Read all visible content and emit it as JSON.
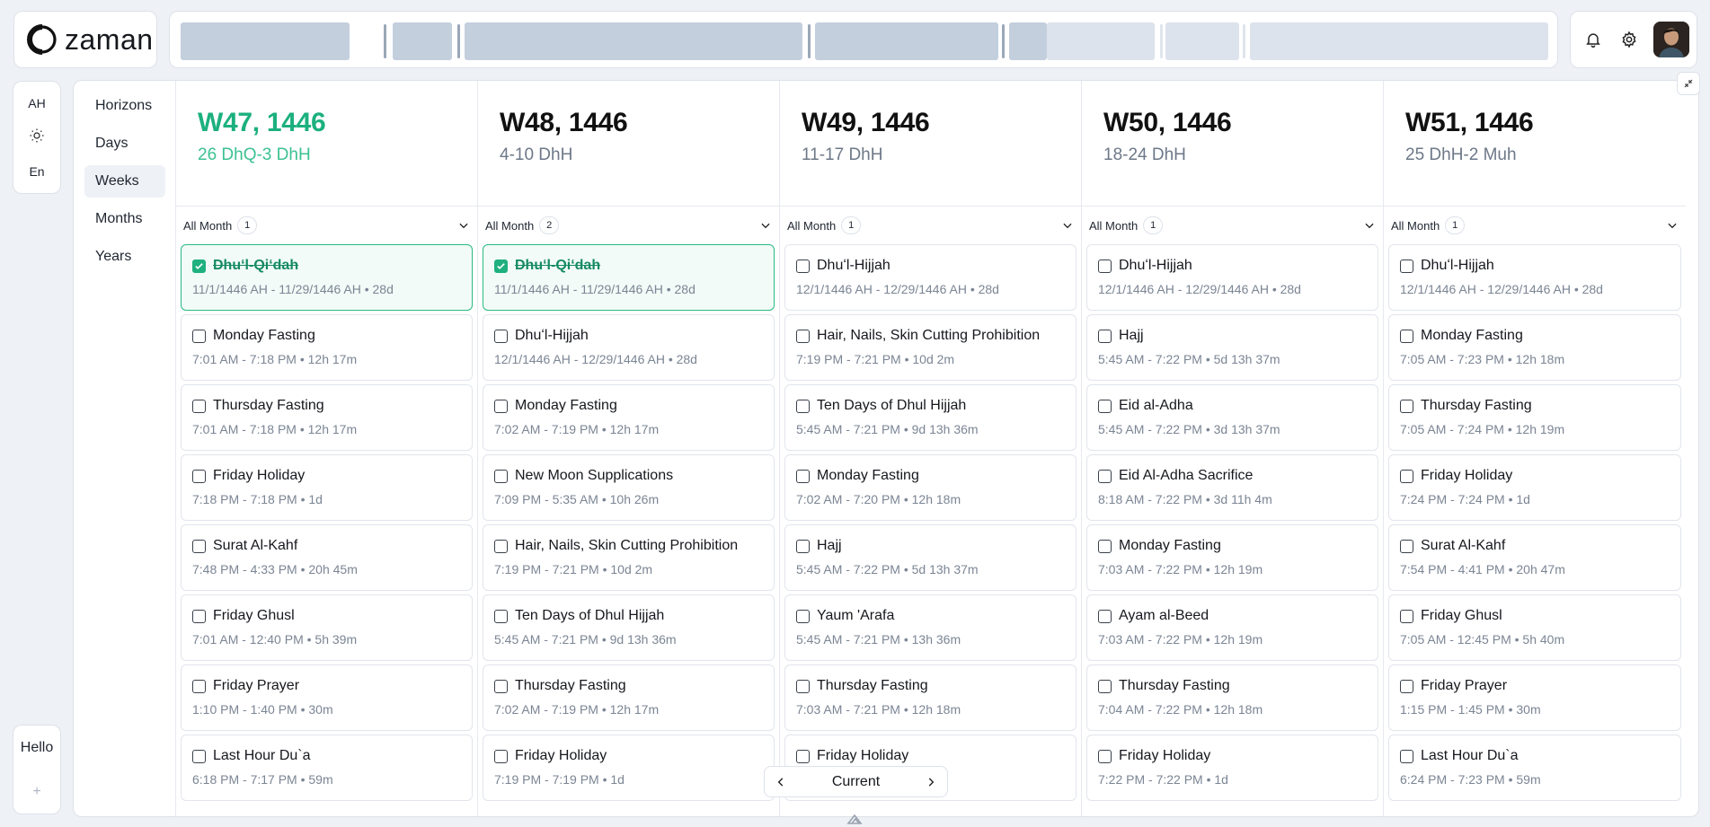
{
  "app": {
    "name": "zaman"
  },
  "rail": {
    "calendar_label": "AH",
    "language_label": "En",
    "theme_icon": "sun-icon"
  },
  "hello": {
    "label": "Hello",
    "add_icon": "plus-icon"
  },
  "header_icons": [
    "bell-icon",
    "gear-icon",
    "avatar"
  ],
  "nav": {
    "items": [
      {
        "label": "Horizons"
      },
      {
        "label": "Days"
      },
      {
        "label": "Weeks"
      },
      {
        "label": "Months"
      },
      {
        "label": "Years"
      }
    ]
  },
  "columns": [
    {
      "title": "W47, 1446",
      "subtitle": "26 DhQ-3 DhH",
      "filter": "All Month",
      "count": "1",
      "cards": [
        {
          "title": "Dhuʻl-Qiʻdah",
          "meta": "11/1/1446 AH - 11/29/1446 AH • 28d",
          "done": true
        },
        {
          "title": "Monday Fasting",
          "meta": "7:01 AM - 7:18 PM • 12h 17m"
        },
        {
          "title": "Thursday Fasting",
          "meta": "7:01 AM - 7:18 PM • 12h 17m"
        },
        {
          "title": "Friday Holiday",
          "meta": "7:18 PM - 7:18 PM • 1d"
        },
        {
          "title": "Surat Al-Kahf",
          "meta": "7:48 PM - 4:33 PM • 20h 45m"
        },
        {
          "title": "Friday Ghusl",
          "meta": "7:01 AM - 12:40 PM • 5h 39m"
        },
        {
          "title": "Friday Prayer",
          "meta": "1:10 PM - 1:40 PM • 30m"
        },
        {
          "title": "Last Hour Du`a",
          "meta": "6:18 PM - 7:17 PM • 59m"
        }
      ]
    },
    {
      "title": "W48, 1446",
      "subtitle": "4-10 DhH",
      "filter": "All Month",
      "count": "2",
      "cards": [
        {
          "title": "Dhuʻl-Qiʻdah",
          "meta": "11/1/1446 AH - 11/29/1446 AH • 28d",
          "done": true
        },
        {
          "title": "Dhuʻl-Hijjah",
          "meta": "12/1/1446 AH - 12/29/1446 AH • 28d"
        },
        {
          "title": "Monday Fasting",
          "meta": "7:02 AM - 7:19 PM • 12h 17m"
        },
        {
          "title": "New Moon Supplications",
          "meta": "7:09 PM - 5:35 AM • 10h 26m"
        },
        {
          "title": "Hair, Nails, Skin Cutting Prohibition",
          "meta": "7:19 PM - 7:21 PM • 10d 2m"
        },
        {
          "title": "Ten Days of Dhul Hijjah",
          "meta": "5:45 AM - 7:21 PM • 9d 13h 36m"
        },
        {
          "title": "Thursday Fasting",
          "meta": "7:02 AM - 7:19 PM • 12h 17m"
        },
        {
          "title": "Friday Holiday",
          "meta": "7:19 PM - 7:19 PM • 1d"
        }
      ]
    },
    {
      "title": "W49, 1446",
      "subtitle": "11-17 DhH",
      "filter": "All Month",
      "count": "1",
      "cards": [
        {
          "title": "Dhuʻl-Hijjah",
          "meta": "12/1/1446 AH - 12/29/1446 AH • 28d"
        },
        {
          "title": "Hair, Nails, Skin Cutting Prohibition",
          "meta": "7:19 PM - 7:21 PM • 10d 2m"
        },
        {
          "title": "Ten Days of Dhul Hijjah",
          "meta": "5:45 AM - 7:21 PM • 9d 13h 36m"
        },
        {
          "title": "Monday Fasting",
          "meta": "7:02 AM - 7:20 PM • 12h 18m"
        },
        {
          "title": "Hajj",
          "meta": "5:45 AM - 7:22 PM • 5d 13h 37m"
        },
        {
          "title": "Yaum 'Arafa",
          "meta": "5:45 AM - 7:21 PM • 13h 36m"
        },
        {
          "title": "Thursday Fasting",
          "meta": "7:03 AM - 7:21 PM • 12h 18m"
        },
        {
          "title": "Friday Holiday",
          "meta": ""
        }
      ]
    },
    {
      "title": "W50, 1446",
      "subtitle": "18-24 DhH",
      "filter": "All Month",
      "count": "1",
      "cards": [
        {
          "title": "Dhuʻl-Hijjah",
          "meta": "12/1/1446 AH - 12/29/1446 AH • 28d"
        },
        {
          "title": "Hajj",
          "meta": "5:45 AM - 7:22 PM • 5d 13h 37m"
        },
        {
          "title": "Eid al-Adha",
          "meta": "5:45 AM - 7:22 PM • 3d 13h 37m"
        },
        {
          "title": "Eid Al-Adha Sacrifice",
          "meta": "8:18 AM - 7:22 PM • 3d 11h 4m"
        },
        {
          "title": "Monday Fasting",
          "meta": "7:03 AM - 7:22 PM • 12h 19m"
        },
        {
          "title": "Ayam al-Beed",
          "meta": "7:03 AM - 7:22 PM • 12h 19m"
        },
        {
          "title": "Thursday Fasting",
          "meta": "7:04 AM - 7:22 PM • 12h 18m"
        },
        {
          "title": "Friday Holiday",
          "meta": "7:22 PM - 7:22 PM • 1d"
        }
      ]
    },
    {
      "title": "W51, 1446",
      "subtitle": "25 DhH-2 Muh",
      "filter": "All Month",
      "count": "1",
      "cards": [
        {
          "title": "Dhuʻl-Hijjah",
          "meta": "12/1/1446 AH - 12/29/1446 AH • 28d"
        },
        {
          "title": "Monday Fasting",
          "meta": "7:05 AM - 7:23 PM • 12h 18m"
        },
        {
          "title": "Thursday Fasting",
          "meta": "7:05 AM - 7:24 PM • 12h 19m"
        },
        {
          "title": "Friday Holiday",
          "meta": "7:24 PM - 7:24 PM • 1d"
        },
        {
          "title": "Surat Al-Kahf",
          "meta": "7:54 PM - 4:41 PM • 20h 47m"
        },
        {
          "title": "Friday Ghusl",
          "meta": "7:05 AM - 12:45 PM • 5h 40m"
        },
        {
          "title": "Friday Prayer",
          "meta": "1:15 PM - 1:45 PM • 30m"
        },
        {
          "title": "Last Hour Du`a",
          "meta": "6:24 PM - 7:23 PM • 59m"
        }
      ]
    }
  ],
  "pager": {
    "label": "Current"
  },
  "colors": {
    "accent": "#1cb07e",
    "muted": "#6d7888",
    "bar": "#c3cfdd"
  }
}
